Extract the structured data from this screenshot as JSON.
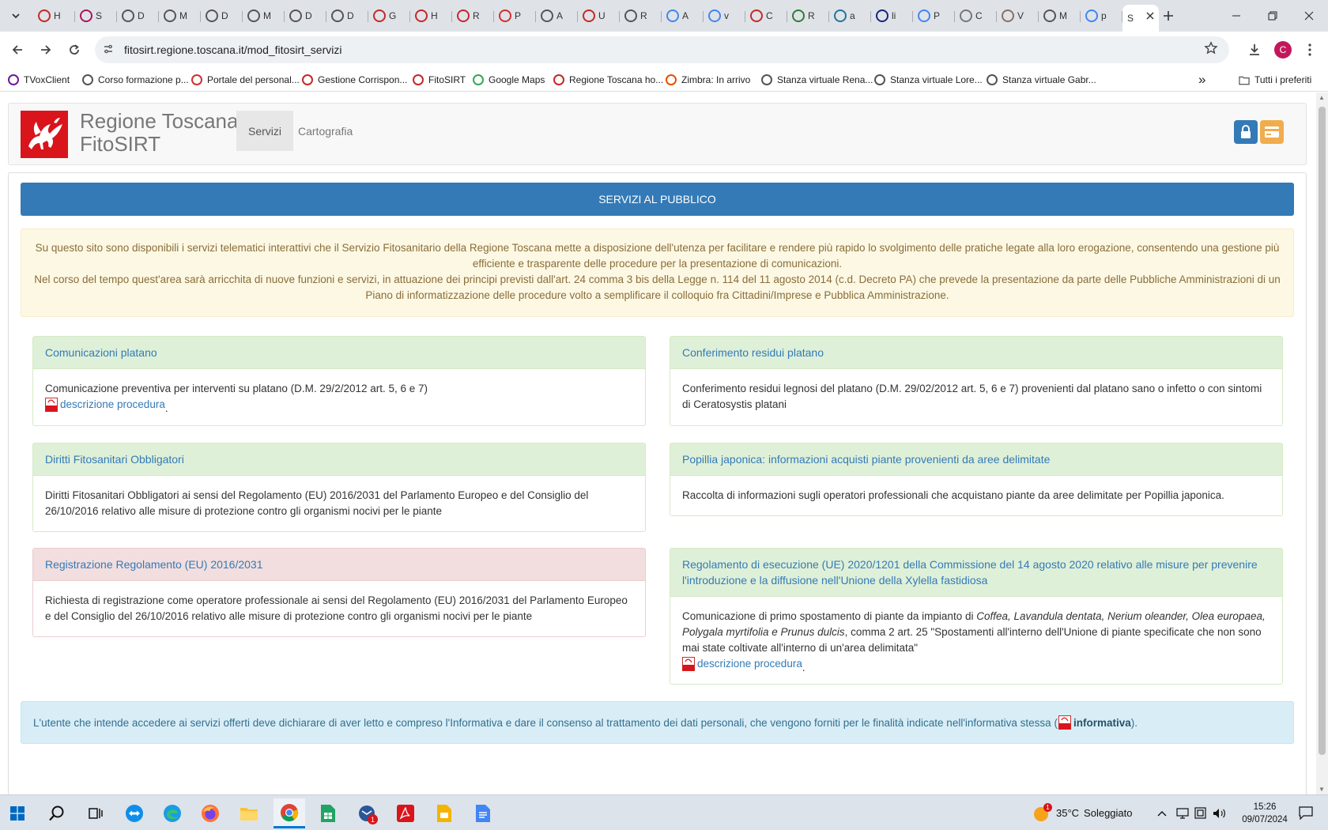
{
  "browser": {
    "tabs": [
      {
        "letter": "H",
        "color": "#c62828"
      },
      {
        "letter": "S",
        "color": "#ad1457"
      },
      {
        "letter": "D",
        "color": "#555555"
      },
      {
        "letter": "M",
        "color": "#555555"
      },
      {
        "letter": "D",
        "color": "#555555"
      },
      {
        "letter": "M",
        "color": "#555555"
      },
      {
        "letter": "D",
        "color": "#555555"
      },
      {
        "letter": "D",
        "color": "#555555"
      },
      {
        "letter": "G",
        "color": "#c62828"
      },
      {
        "letter": "H",
        "color": "#c62828"
      },
      {
        "letter": "R",
        "color": "#c62828"
      },
      {
        "letter": "P",
        "color": "#d32f2f"
      },
      {
        "letter": "A",
        "color": "#555555"
      },
      {
        "letter": "U",
        "color": "#c62828"
      },
      {
        "letter": "R",
        "color": "#555555"
      },
      {
        "letter": "A",
        "color": "#4285f4"
      },
      {
        "letter": "v",
        "color": "#4285f4"
      },
      {
        "letter": "C",
        "color": "#c62828"
      },
      {
        "letter": "R",
        "color": "#2e7d32"
      },
      {
        "letter": "a",
        "color": "#21759b"
      },
      {
        "letter": "li",
        "color": "#1a237e"
      },
      {
        "letter": "P",
        "color": "#4285f4"
      },
      {
        "letter": "C",
        "color": "#777777"
      },
      {
        "letter": "V",
        "color": "#8d6e63"
      },
      {
        "letter": "M",
        "color": "#555555"
      },
      {
        "letter": "p",
        "color": "#4285f4"
      }
    ],
    "active_tab_letter": "S",
    "url": "fitosirt.regione.toscana.it/mod_fitosirt_servizi",
    "profile_initial": "C",
    "bookmarks": [
      {
        "label": "TVoxClient",
        "color": "#6a1b9a"
      },
      {
        "label": "Corso formazione p...",
        "color": "#555555"
      },
      {
        "label": "Portale del personal...",
        "color": "#d32f2f"
      },
      {
        "label": "Gestione Corrispon...",
        "color": "#c62828"
      },
      {
        "label": "FitoSIRT",
        "color": "#c62828"
      },
      {
        "label": "Google Maps",
        "color": "#34a853"
      },
      {
        "label": "Regione Toscana ho...",
        "color": "#c62828"
      },
      {
        "label": "Zimbra: In arrivo",
        "color": "#e65100"
      },
      {
        "label": "Stanza virtuale Rena...",
        "color": "#555555"
      },
      {
        "label": "Stanza virtuale Lore...",
        "color": "#555555"
      },
      {
        "label": "Stanza virtuale Gabr...",
        "color": "#555555"
      }
    ],
    "more_bookmarks": "»",
    "all_bookmarks": "Tutti i preferiti"
  },
  "site": {
    "brand_line1": "Regione Toscana",
    "brand_line2": "FitoSIRT",
    "nav": [
      {
        "label": "Servizi",
        "active": true
      },
      {
        "label": "Cartografia",
        "active": false
      }
    ],
    "accent_blue": "#337ab7",
    "accent_orange": "#f0ad4e"
  },
  "main": {
    "banner": "SERVIZI AL PUBBLICO",
    "intro_p1": "Su questo sito sono disponibili i servizi telematici interattivi che il Servizio Fitosanitario della Regione Toscana mette a disposizione dell'utenza per facilitare e rendere più rapido lo svolgimento delle pratiche legate alla loro erogazione, consentendo una gestione più efficiente e trasparente delle procedure per la presentazione di comunicazioni.",
    "intro_p2": "Nel corso del tempo quest'area sarà arricchita di nuove funzioni e servizi, in attuazione dei principi previsti dall'art. 24 comma 3 bis della Legge n. 114 del 11 agosto 2014 (c.d. Decreto PA) che prevede la presentazione da parte delle Pubbliche Amministrazioni di un Piano di informatizzazione delle procedure volto a semplificare il colloquio fra Cittadini/Imprese e Pubblica Amministrazione.",
    "panels": {
      "comunicazioni": {
        "title": "Comunicazioni platano",
        "body": "Comunicazione preventiva per interventi su platano (D.M. 29/2/2012 art. 5, 6 e 7)",
        "link": "descrizione procedura"
      },
      "conferimento": {
        "title": "Conferimento residui platano",
        "body": "Conferimento residui legnosi del platano (D.M. 29/02/2012 art. 5, 6 e 7) provenienti dal platano sano o infetto o con sintomi di Ceratosystis platani"
      },
      "diritti": {
        "title": "Diritti Fitosanitari Obbligatori",
        "body": "Diritti Fitosanitari Obbligatori ai sensi del Regolamento (EU) 2016/2031 del Parlamento Europeo e del Consiglio del 26/10/2016 relativo alle misure di protezione contro gli organismi nocivi per le piante"
      },
      "popillia": {
        "title": "Popillia japonica: informazioni acquisti piante provenienti da aree delimitate",
        "body": "Raccolta di informazioni sugli operatori professionali che acquistano piante da aree delimitate per Popillia japonica."
      },
      "registrazione": {
        "title": "Registrazione Regolamento (EU) 2016/2031",
        "body": "Richiesta di registrazione come operatore professionale ai sensi del Regolamento (EU) 2016/2031 del Parlamento Europeo e del Consiglio del 26/10/2016 relativo alle misure di protezione contro gli organismi nocivi per le piante"
      },
      "xylella": {
        "title": "Regolamento di esecuzione (UE) 2020/1201 della Commissione del 14 agosto 2020 relativo alle misure per prevenire l'introduzione e la diffusione nell'Unione della Xylella fastidiosa",
        "body_pre": "Comunicazione di primo spostamento di piante da impianto di ",
        "body_italic": "Coffea, Lavandula dentata, Nerium oleander, Olea europaea, Polygala myrtifolia e Prunus dulcis",
        "body_post": ", comma 2 art. 25 \"Spostamenti all'interno dell'Unione di piante specificate che non sono mai state coltivate all'interno di un'area delimitata\"",
        "link": "descrizione procedura"
      }
    },
    "info_pre": "L'utente che intende accedere ai servizi offerti deve dichiarare di aver letto e compreso l'Informativa e dare il consenso al trattamento dei dati personali, che vengono forniti per le finalità indicate nell'informativa stessa (",
    "info_link": "informativa",
    "info_post": ").",
    "link_suffix": "."
  },
  "taskbar": {
    "weather_temp": "35°C",
    "weather_text": "Soleggiato",
    "weather_badge": "1",
    "mail_badge": "1",
    "time": "15:26",
    "date": "09/07/2024"
  }
}
